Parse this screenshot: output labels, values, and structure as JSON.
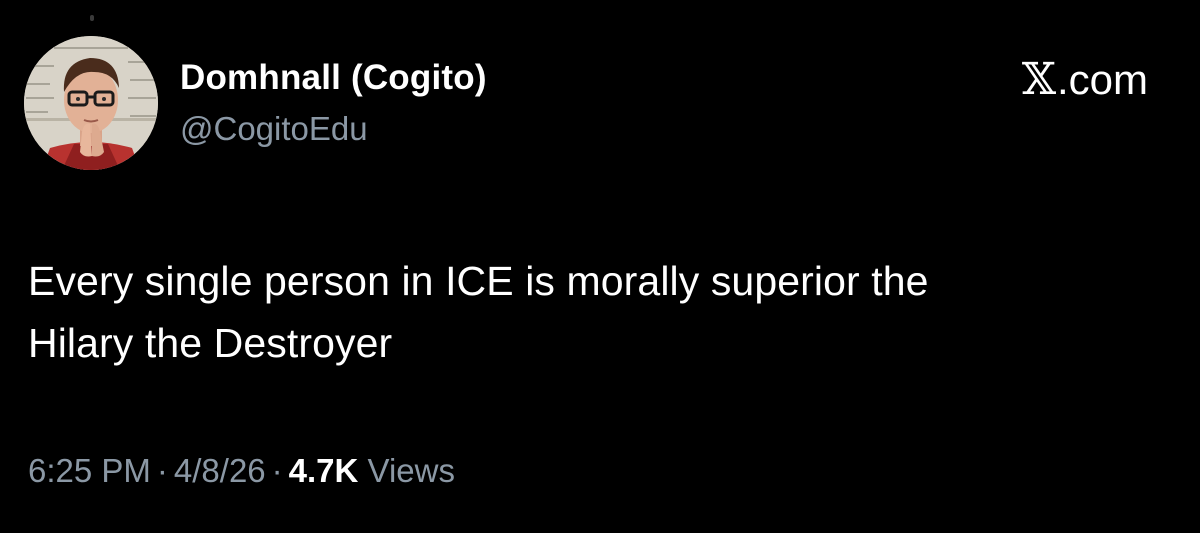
{
  "tweet": {
    "author": {
      "display_name": "Domhnall (Cogito)",
      "handle": "@CogitoEdu",
      "avatar_icon": "profile-photo"
    },
    "brand": {
      "symbol": "𝕏",
      "suffix": ".com"
    },
    "text_line_1": "Every single person in ICE is morally superior the",
    "text_line_2": "Hilary the Destroyer",
    "meta": {
      "time": "6:25 PM",
      "separator": "·",
      "date": "4/8/26",
      "views_count": "4.7K",
      "views_label": "Views"
    }
  },
  "colors": {
    "background": "#000000",
    "primary_text": "#ffffff",
    "secondary_text": "#8b98a5"
  }
}
